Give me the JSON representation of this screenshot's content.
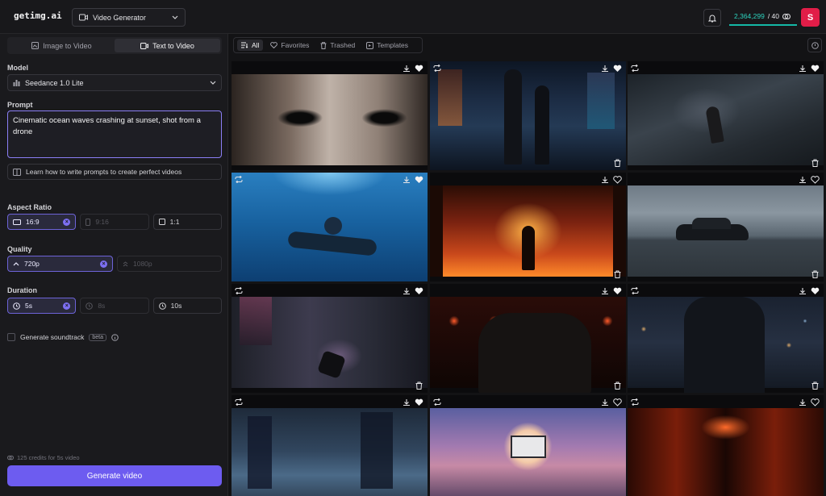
{
  "app": {
    "logo": "getimg.ai",
    "tool_select": "Video Generator"
  },
  "header": {
    "credits_used": "2,364,299",
    "credits_limit": "/ 40",
    "avatar_letter": "S"
  },
  "sidebar": {
    "tabs": [
      "Image to Video",
      "Text to Video"
    ],
    "active_tab": 1,
    "model_label": "Model",
    "model_value": "Seedance 1.0 Lite",
    "prompt_label": "Prompt",
    "prompt_value": "Cinematic ocean waves crashing at sunset, shot from a drone",
    "learn_link": "Learn how to write prompts to create perfect videos",
    "aspect_label": "Aspect Ratio",
    "aspect_options": [
      "16:9",
      "9:16",
      "1:1"
    ],
    "aspect_selected": "16:9",
    "quality_label": "Quality",
    "quality_options": [
      "720p",
      "1080p"
    ],
    "quality_selected": "720p",
    "duration_label": "Duration",
    "duration_options": [
      "5s",
      "8s",
      "10s"
    ],
    "duration_selected": "5s",
    "soundtrack_label": "Generate soundtrack",
    "soundtrack_badge": "beta",
    "soundtrack_checked": false,
    "cost_note": "125 credits for 5s video",
    "generate_button": "Generate video"
  },
  "gallery": {
    "filters": [
      "All",
      "Favorites",
      "Trashed",
      "Templates"
    ],
    "active_filter": "All",
    "items": [
      {
        "subject": "close-up-eyes",
        "favorited": true
      },
      {
        "subject": "neon-street-couple",
        "favorited": true
      },
      {
        "subject": "hand-from-waves",
        "favorited": true
      },
      {
        "subject": "underwater-swimmer",
        "favorited": true
      },
      {
        "subject": "fire-doorway",
        "favorited": false
      },
      {
        "subject": "car-on-runway",
        "favorited": false
      },
      {
        "subject": "neon-motorcycle",
        "favorited": true
      },
      {
        "subject": "soldier-red-lights",
        "favorited": true
      },
      {
        "subject": "city-silhouette",
        "favorited": true
      },
      {
        "subject": "rainy-city-night",
        "favorited": true
      },
      {
        "subject": "sunset-drive-in",
        "favorited": false
      },
      {
        "subject": "red-corridor",
        "favorited": false
      }
    ]
  }
}
